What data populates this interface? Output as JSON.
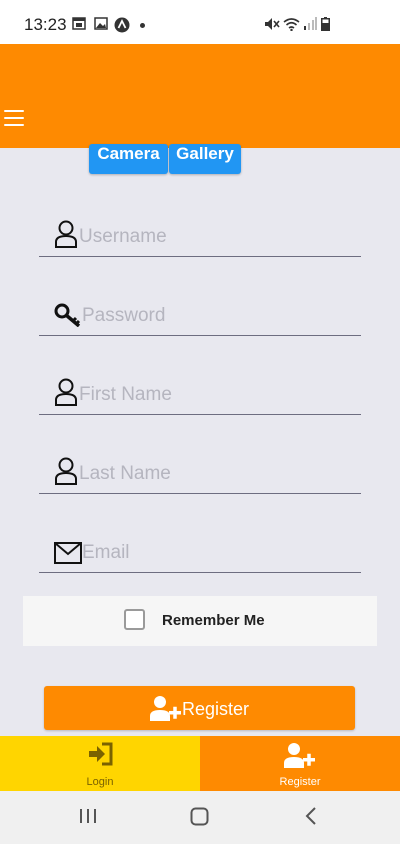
{
  "status_bar": {
    "time": "13:23"
  },
  "photo_buttons": {
    "camera": "Camera",
    "gallery": "Gallery"
  },
  "form": {
    "username_placeholder": "Username",
    "password_placeholder": "Password",
    "first_name_placeholder": "First Name",
    "last_name_placeholder": "Last Name",
    "email_placeholder": "Email",
    "remember_me": "Remember Me",
    "remember_checked": false
  },
  "register_button": {
    "label": "Register"
  },
  "bottom_tabs": [
    {
      "label": "Login",
      "icon": "login-icon"
    },
    {
      "label": "Register",
      "icon": "add-user-icon",
      "active": true
    }
  ],
  "colors": {
    "app_bar": "#fe8a01",
    "photo_button": "#2196f3",
    "login_tab": "#ffd500",
    "register_tab": "#fe8a01",
    "background": "#e8e8ef"
  }
}
